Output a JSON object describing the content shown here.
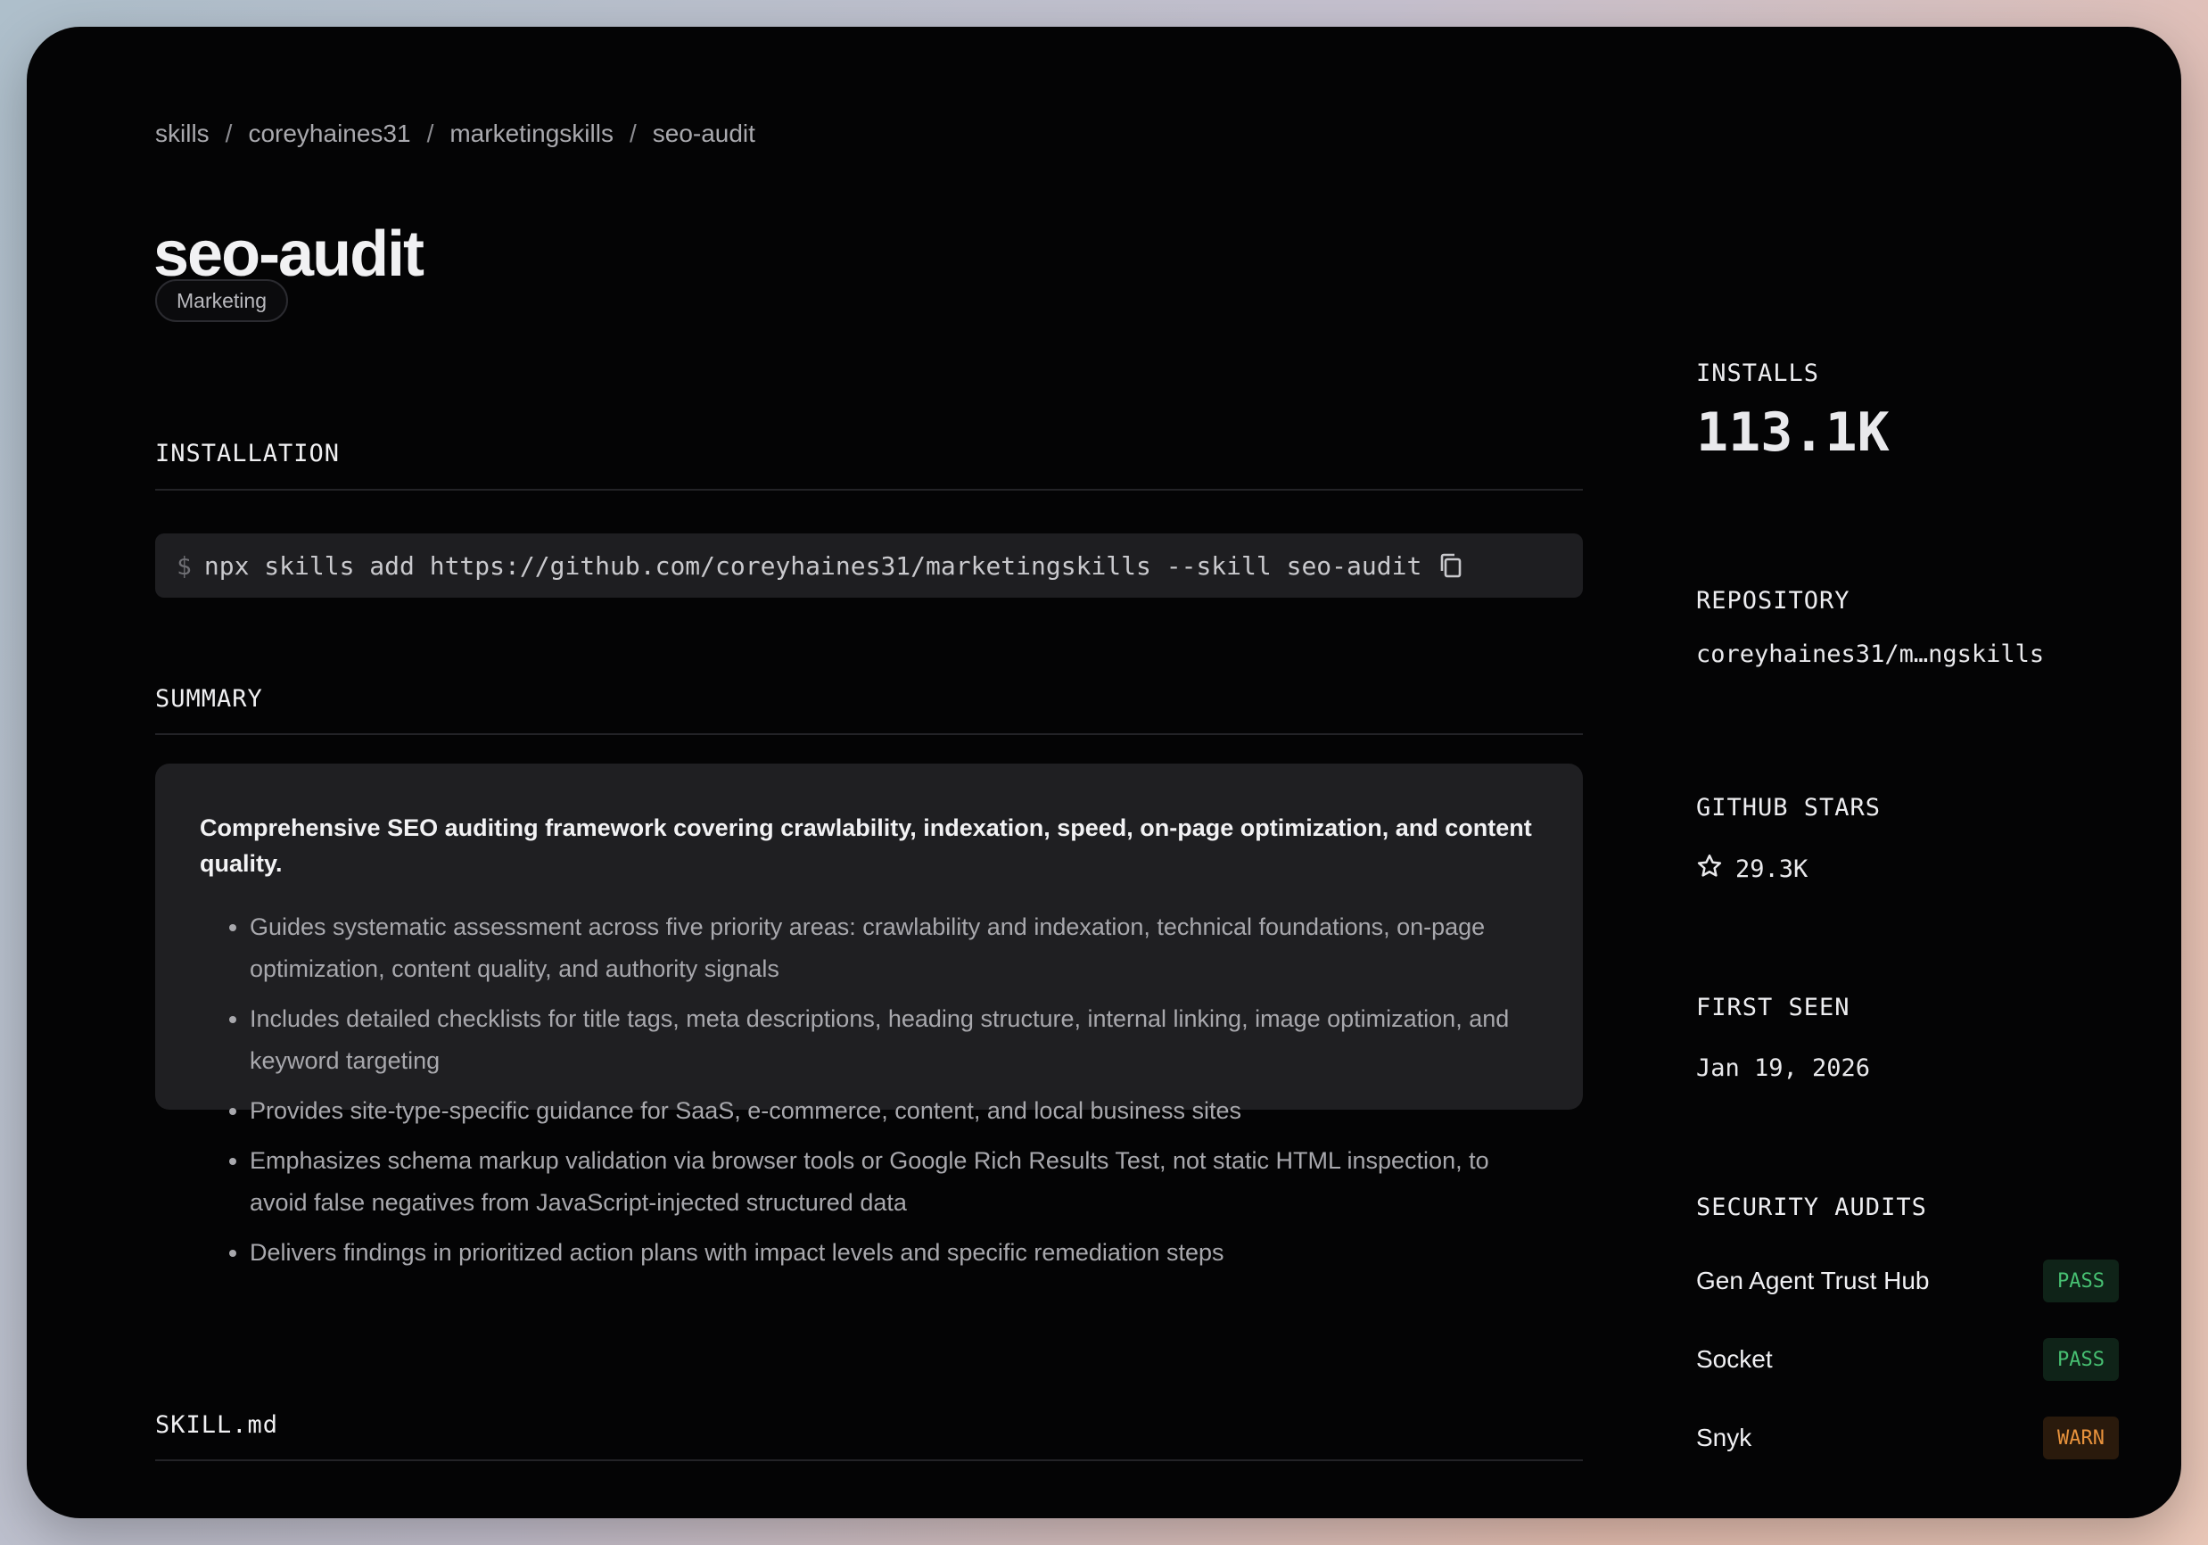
{
  "breadcrumb": {
    "items": [
      "skills",
      "coreyhaines31",
      "marketingskills",
      "seo-audit"
    ],
    "separator": "/"
  },
  "skill": {
    "title": "seo-audit",
    "tag": "Marketing"
  },
  "installation": {
    "label": "INSTALLATION",
    "prompt": "$",
    "command": "npx skills add https://github.com/coreyhaines31/marketingskills --skill seo-audit",
    "copy_icon": "copy-icon"
  },
  "summary": {
    "label": "SUMMARY",
    "lead": "Comprehensive SEO auditing framework covering crawlability, indexation, speed, on-page optimization, and content quality.",
    "bullets": [
      "Guides systematic assessment across five priority areas: crawlability and indexation, technical foundations, on-page optimization, content quality, and authority signals",
      "Includes detailed checklists for title tags, meta descriptions, heading structure, internal linking, image optimization, and keyword targeting",
      "Provides site-type-specific guidance for SaaS, e-commerce, content, and local business sites",
      "Emphasizes schema markup validation via browser tools or Google Rich Results Test, not static HTML inspection, to avoid false negatives from JavaScript-injected structured data",
      "Delivers findings in prioritized action plans with impact levels and specific remediation steps"
    ]
  },
  "skill_md": {
    "label": "SKILL.md"
  },
  "sidebar": {
    "installs_label": "INSTALLS",
    "installs_value": "113.1K",
    "repository_label": "REPOSITORY",
    "repository_value": "coreyhaines31/m…ngskills",
    "stars_label": "GITHUB STARS",
    "stars_value": "29.3K",
    "stars_icon": "star-icon",
    "first_seen_label": "FIRST SEEN",
    "first_seen_value": "Jan 19, 2026",
    "audits_label": "SECURITY AUDITS",
    "audits": [
      {
        "name": "Gen Agent Trust Hub",
        "status": "PASS"
      },
      {
        "name": "Socket",
        "status": "PASS"
      },
      {
        "name": "Snyk",
        "status": "WARN"
      }
    ]
  },
  "colors": {
    "pass": "#47c072",
    "warn": "#e8923c",
    "background": "#040405",
    "panel": "#1f1f22"
  }
}
